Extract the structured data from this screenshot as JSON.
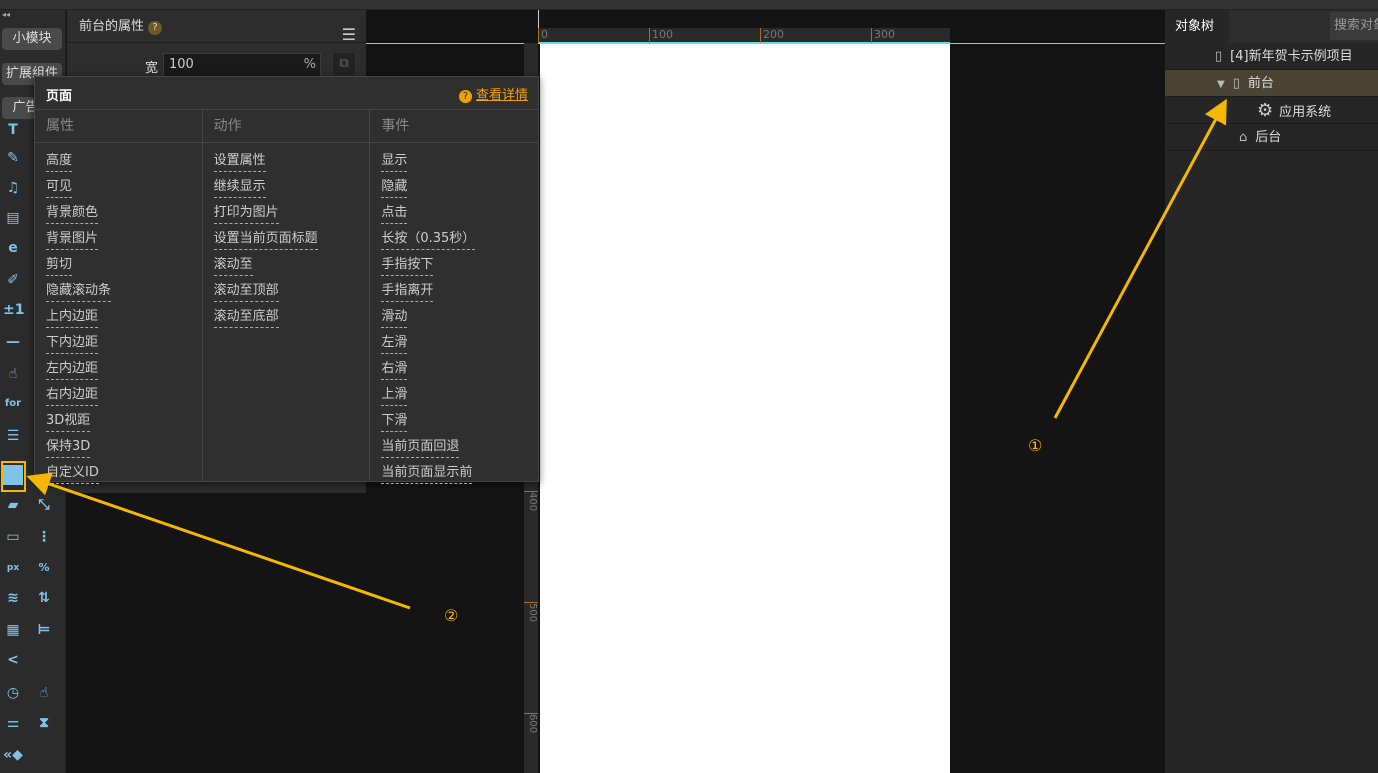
{
  "left": {
    "buttons": [
      "小模块",
      "扩展组件",
      "广告组"
    ]
  },
  "props": {
    "title": "前台的属性",
    "help": "?",
    "width_label": "宽",
    "width_value": "100",
    "width_unit": "%"
  },
  "ruler": {
    "top": [
      "0",
      "100",
      "200",
      "300"
    ],
    "left": [
      "400",
      "500",
      "600"
    ]
  },
  "right": {
    "tab": "对象树",
    "search_placeholder": "搜索对象",
    "tree": [
      {
        "label": "[4]新年贺卡示例项目",
        "icon": "project-icon"
      },
      {
        "label": "前台",
        "icon": "phone-icon",
        "selected": true,
        "expanded": true
      },
      {
        "label": "应用系统",
        "icon": "gear-icon"
      },
      {
        "label": "后台",
        "icon": "server-icon"
      }
    ]
  },
  "popup": {
    "title": "页面",
    "link": "查看详情",
    "columns": [
      {
        "header": "属性",
        "items": [
          "高度",
          "可见",
          "背景颜色",
          "背景图片",
          "剪切",
          "隐藏滚动条",
          "上内边距",
          "下内边距",
          "左内边距",
          "右内边距",
          "3D视距",
          "保持3D",
          "自定义ID"
        ]
      },
      {
        "header": "动作",
        "items": [
          "设置属性",
          "继续显示",
          "打印为图片",
          "设置当前页面标题",
          "滚动至",
          "滚动至顶部",
          "滚动至底部"
        ]
      },
      {
        "header": "事件",
        "items": [
          "显示",
          "隐藏",
          "点击",
          "长按（0.35秒）",
          "手指按下",
          "手指离开",
          "滑动",
          "左滑",
          "右滑",
          "上滑",
          "下滑",
          "当前页面回退",
          "当前页面显示前"
        ]
      }
    ]
  },
  "annotations": {
    "one": "①",
    "two": "②"
  },
  "colors": {
    "accent": "#f5b800",
    "link": "#f5a000",
    "guide": "#5ee0e6",
    "selected_row": "#4a4334"
  }
}
